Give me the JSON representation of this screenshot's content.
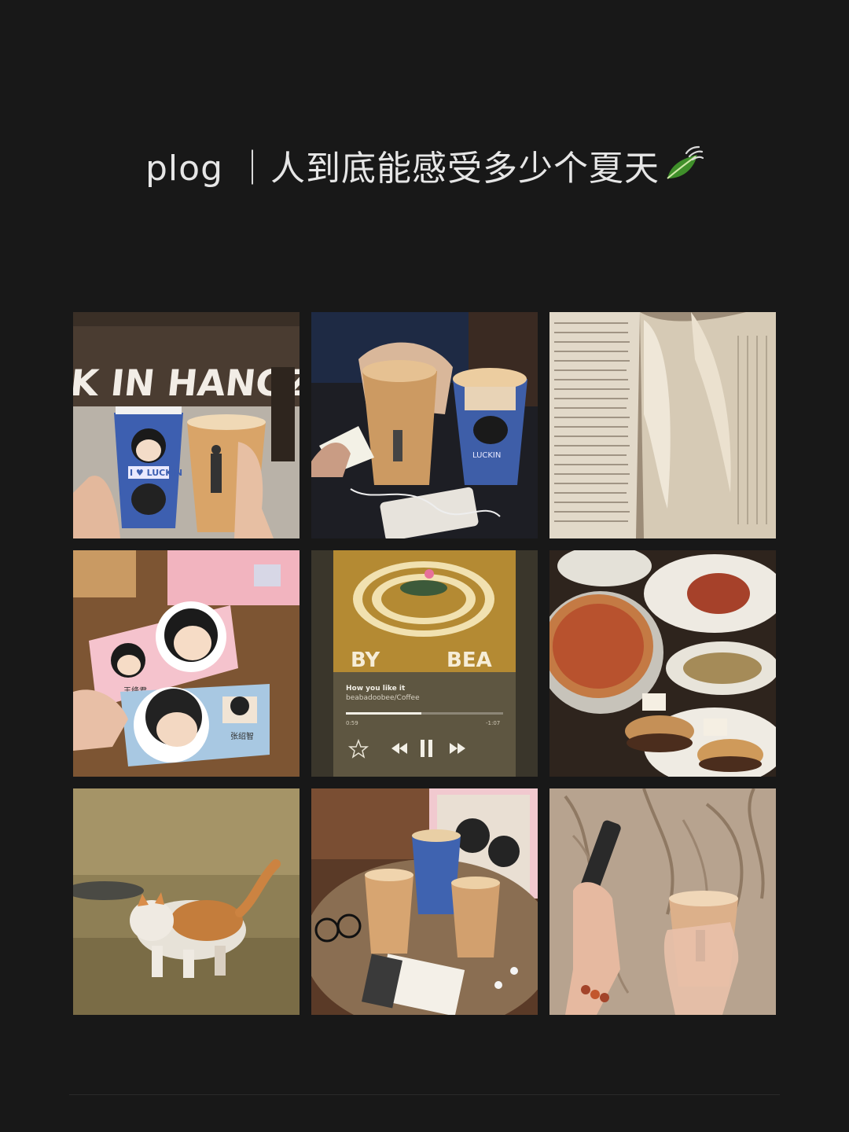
{
  "post": {
    "title": "plog ｜人到底能感受多少个夏天",
    "title_emoji_icon": "leaf-emoji-icon"
  },
  "photos": [
    {
      "icon": "coffee-cups-hangzhou-photo",
      "sign_text": "K IN HANGZHOU",
      "cup_text": "I ♥ LUCKIN"
    },
    {
      "icon": "iced-coffee-headphones-photo",
      "cup_text": "LUCKIN"
    },
    {
      "icon": "open-book-photo"
    },
    {
      "icon": "anime-stickers-photo",
      "sticker_name_1": "王绛君",
      "sticker_name_2": "张绍智"
    },
    {
      "icon": "music-player-screenshot-photo",
      "album_left": "BY",
      "album_right": "BEA",
      "song": "How you like it",
      "artist": "beabadoobee/Coffee",
      "time_elapsed": "0:59",
      "time_remaining": "-1:07",
      "progress": 0.48
    },
    {
      "icon": "pizza-pasta-dinner-photo"
    },
    {
      "icon": "orange-white-cat-photo"
    },
    {
      "icon": "cafe-table-drinks-photo"
    },
    {
      "icon": "hand-holding-latte-photo"
    }
  ],
  "colors": {
    "background": "#181818",
    "title": "#e6e6e6"
  }
}
